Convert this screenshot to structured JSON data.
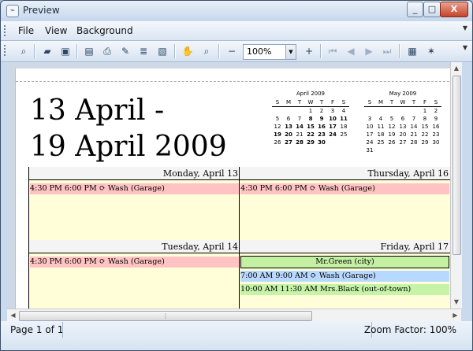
{
  "window": {
    "title": "Preview",
    "buttons": [
      "_",
      "□",
      "X"
    ]
  },
  "menubar": {
    "items": [
      "File",
      "View",
      "Background"
    ]
  },
  "toolbar": {
    "zoom_value": "100%"
  },
  "calendar": {
    "date_range_line1": "13 April -",
    "date_range_line2": "19 April 2009",
    "mini_calendars": [
      {
        "title": "April 2009",
        "weekday_headers": [
          "S",
          "M",
          "T",
          "W",
          "T",
          "F",
          "S"
        ],
        "weeks": [
          [
            "",
            "",
            "",
            "1",
            "2",
            "3",
            "4"
          ],
          [
            "5",
            "6",
            "7",
            "8",
            "9",
            "10",
            "11"
          ],
          [
            "12",
            "13",
            "14",
            "15",
            "16",
            "17",
            "18"
          ],
          [
            "19",
            "20",
            "21",
            "22",
            "23",
            "24",
            "25"
          ],
          [
            "26",
            "27",
            "28",
            "29",
            "30",
            "",
            ""
          ]
        ]
      },
      {
        "title": "May 2009",
        "weekday_headers": [
          "S",
          "M",
          "T",
          "W",
          "T",
          "F",
          "S"
        ],
        "weeks": [
          [
            "",
            "",
            "",
            "",
            "",
            "1",
            "2"
          ],
          [
            "3",
            "4",
            "5",
            "6",
            "7",
            "8",
            "9"
          ],
          [
            "10",
            "11",
            "12",
            "13",
            "14",
            "15",
            "16"
          ],
          [
            "17",
            "18",
            "19",
            "20",
            "21",
            "22",
            "23"
          ],
          [
            "24",
            "25",
            "26",
            "27",
            "28",
            "29",
            "30"
          ],
          [
            "31",
            "",
            "",
            "",
            "",
            "",
            ""
          ]
        ]
      }
    ],
    "days": [
      {
        "header": "Monday, April 13",
        "events": [
          {
            "text": "4:30 PM 6:00 PM ⟳ Wash (Garage)",
            "color": "#ffc3c3"
          }
        ]
      },
      {
        "header": "Thursday, April 16",
        "events": [
          {
            "text": "4:30 PM 6:00 PM ⟳ Wash (Garage)",
            "color": "#ffc3c3"
          }
        ]
      },
      {
        "header": "Tuesday, April 14",
        "events": [
          {
            "text": "4:30 PM 6:00 PM ⟳ Wash (Garage)",
            "color": "#ffc3c3"
          }
        ]
      },
      {
        "header": "Friday, April 17",
        "events": [
          {
            "text": "Mr.Green (city)",
            "color": "#c3f0a3"
          },
          {
            "text": "7:00 AM 9:00 AM ⟳ Wash (Garage)",
            "color": "#b8d9ff"
          },
          {
            "text": "10:00 AM 11:30 AM Mrs.Black (out-of-town)",
            "color": "#c6f3a8"
          }
        ]
      }
    ]
  },
  "status": {
    "page_text": "Page 1 of 1",
    "zoom_text": "Zoom Factor: 100%"
  }
}
